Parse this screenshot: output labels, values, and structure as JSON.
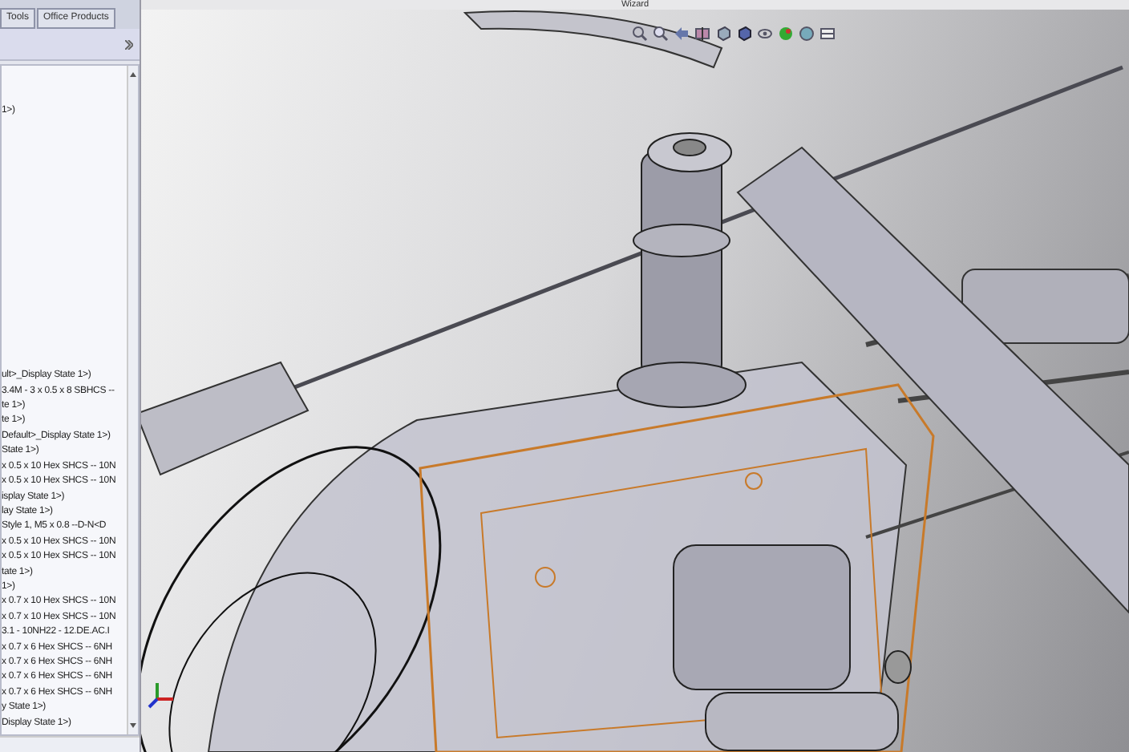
{
  "tabs": [
    {
      "label": "Tools"
    },
    {
      "label": "Office Products"
    }
  ],
  "viewport": {
    "title": "Wizard"
  },
  "tree_items_upper": [
    "1>)"
  ],
  "tree_items_lower": [
    "ult>_Display State 1>)",
    "3.4M - 3 x 0.5 x 8 SBHCS --",
    "te 1>)",
    "te 1>)",
    "Default>_Display State 1>)",
    "State 1>)",
    "x 0.5 x 10 Hex SHCS -- 10N",
    "x 0.5 x 10 Hex SHCS -- 10N",
    "isplay State 1>)",
    "lay State 1>)",
    "Style 1,  M5 x 0.8 --D-N<D",
    "x 0.5 x 10 Hex SHCS -- 10N",
    "x 0.5 x 10 Hex SHCS -- 10N",
    "tate 1>)",
    "1>)",
    "x 0.7 x 10 Hex SHCS -- 10N",
    "x 0.7 x 10 Hex SHCS -- 10N",
    "3.1 - 10NH22 - 12.DE.AC.I",
    "x 0.7 x 6 Hex SHCS -- 6NH",
    "x 0.7 x 6 Hex SHCS -- 6NH",
    "x 0.7 x 6 Hex SHCS -- 6NH",
    "x 0.7 x 6 Hex SHCS -- 6NH",
    "y State 1>)",
    "Display State 1>)"
  ]
}
